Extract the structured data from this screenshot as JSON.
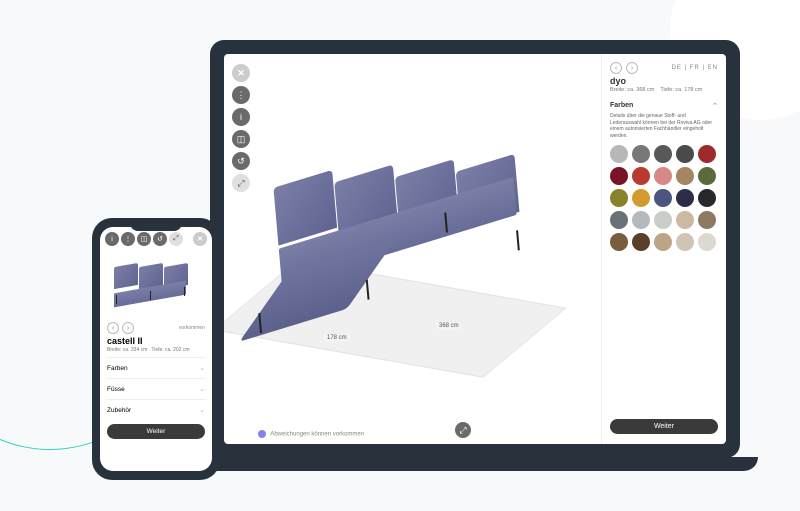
{
  "laptop": {
    "languages": "DE | FR | EN",
    "product_name": "dyo",
    "width_label": "Breite: ca. 368 cm",
    "depth_label": "Tiefe: ca. 178 cm",
    "section_colors_title": "Farben",
    "colors_desc": "Details über die genaue Stoff- und Lederauswahl können bei der Roviva AG oder einem autorisierten Fachhändler eingeholt werden.",
    "swatches": [
      "#b6b8b6",
      "#777877",
      "#585858",
      "#4b4b4b",
      "#9e2b2b",
      "#7a1228",
      "#b73b2e",
      "#d78a85",
      "#a38463",
      "#5b6a3c",
      "#868328",
      "#d49a2e",
      "#4a5580",
      "#2c2e47",
      "#26282c",
      "#6a7177",
      "#b4b9bd",
      "#caccc7",
      "#cbb9a1",
      "#8e7a63",
      "#7a5c3e",
      "#5a3e27",
      "#bca489",
      "#d0c4b5",
      "#dcd9d3"
    ],
    "continue_label": "Weiter",
    "viewport_footer": "Abweichungen können vorkommen",
    "dim_width": "178 cm",
    "dim_length": "368 cm"
  },
  "phone": {
    "product_name": "castell II",
    "width_label": "Breite: ca. 334 cm",
    "depth_label": "Tiefe: ca. 202 cm",
    "footer_hint": "vorkommen",
    "sections": {
      "colors": "Farben",
      "feet": "Füsse",
      "accessories": "Zubehör"
    },
    "continue_label": "Weiter"
  },
  "icons": {
    "close": "✕",
    "dots": "⋮",
    "info": "i",
    "ruler": "◫",
    "reset": "↺",
    "zoom": "⤢",
    "expand": "⤢",
    "prev": "‹",
    "next": "›",
    "chev_down": "⌄",
    "chev_up": "⌃"
  }
}
